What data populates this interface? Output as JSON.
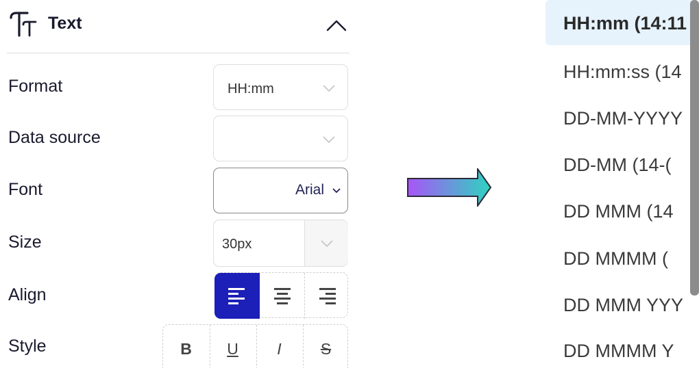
{
  "panel": {
    "title": "Text",
    "icon": "text-format-icon",
    "collapse_icon": "chevron-up-icon"
  },
  "fields": {
    "format": {
      "label": "Format",
      "value": "HH:mm"
    },
    "data_source": {
      "label": "Data source",
      "value": ""
    },
    "font": {
      "label": "Font",
      "value": "Arial"
    },
    "size": {
      "label": "Size",
      "value": "30px"
    },
    "align": {
      "label": "Align",
      "options": [
        "left",
        "center",
        "right"
      ],
      "selected": "left"
    },
    "style": {
      "label": "Style",
      "options": [
        "B",
        "U",
        "I",
        "S"
      ]
    }
  },
  "colors": {
    "accent": "#1c1fb8",
    "selected_row": "#e6f2fc",
    "arrow_start": "#a855f7",
    "arrow_end": "#2dd4bf"
  },
  "format_dropdown": {
    "selected_index": 0,
    "items": [
      "HH:mm (14:11",
      "HH:mm:ss (14",
      "DD-MM-YYYY",
      "DD-MM (14-(",
      "DD MMM (14",
      "DD MMMM (",
      "DD MMM YYY",
      "DD MMMM Y"
    ]
  }
}
